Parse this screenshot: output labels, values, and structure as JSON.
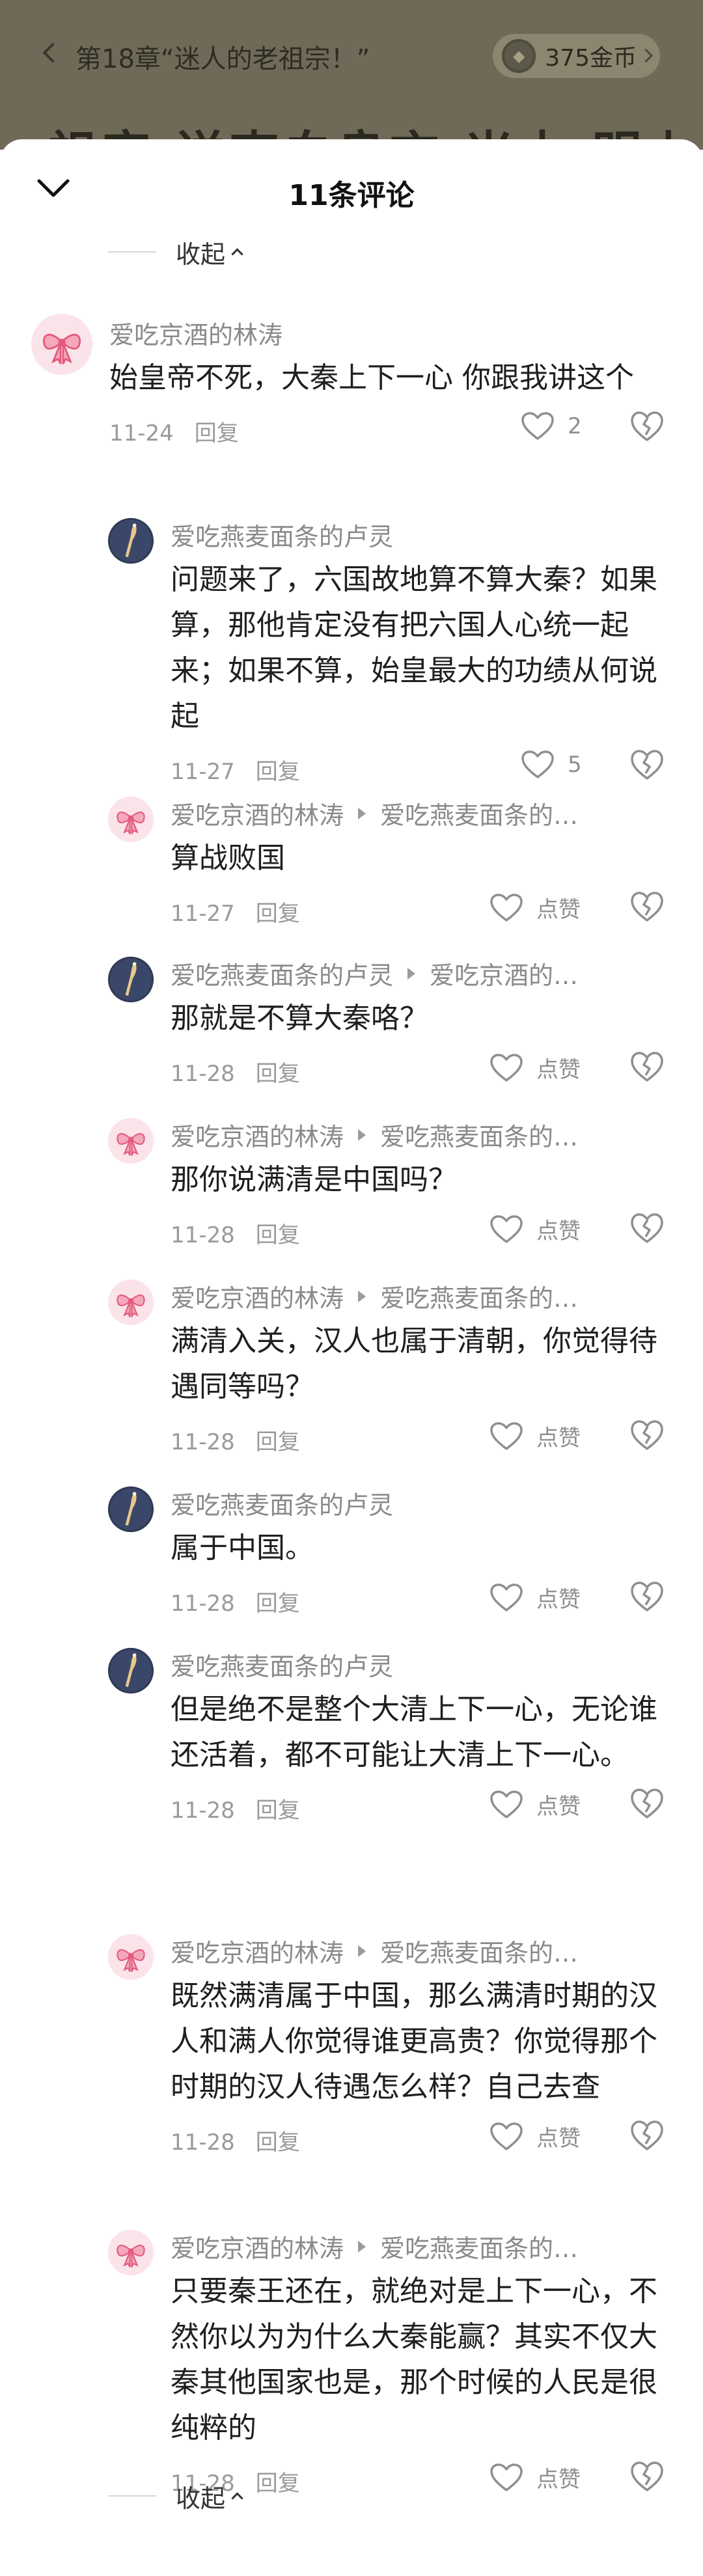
{
  "reader": {
    "back_label": "第18章“迷人的老祖宗！”",
    "coins_label": "375金币",
    "coin_glyph": "◆",
    "body_fragment": "祖宗  送李白良言  米十  明上"
  },
  "sheet": {
    "title": "11条评论",
    "collapse_label": "收起"
  },
  "comments": [
    {
      "user": "爱吃京酒的林涛",
      "target": "",
      "text": "始皇帝不死，大秦上下一心 你跟我讲这个",
      "date": "11-24",
      "reply": "回复",
      "likes": "2",
      "avatar": "lin"
    },
    {
      "user": "爱吃燕麦面条的卢灵",
      "target": "",
      "text": "问题来了，六国故地算不算大秦？如果算，那他肯定没有把六国人心统一起来；如果不算，始皇最大的功绩从何说起",
      "date": "11-27",
      "reply": "回复",
      "likes": "5",
      "avatar": "lu"
    },
    {
      "user": "爱吃京酒的林涛",
      "target": "爱吃燕麦面条的…",
      "text": "算战败国",
      "date": "11-27",
      "reply": "回复",
      "likes": "点赞",
      "avatar": "lin"
    },
    {
      "user": "爱吃燕麦面条的卢灵",
      "target": "爱吃京酒的…",
      "text": "那就是不算大秦咯？",
      "date": "11-28",
      "reply": "回复",
      "likes": "点赞",
      "avatar": "lu"
    },
    {
      "user": "爱吃京酒的林涛",
      "target": "爱吃燕麦面条的…",
      "text": "那你说满清是中国吗？",
      "date": "11-28",
      "reply": "回复",
      "likes": "点赞",
      "avatar": "lin"
    },
    {
      "user": "爱吃京酒的林涛",
      "target": "爱吃燕麦面条的…",
      "text": "满清入关，汉人也属于清朝，你觉得待遇同等吗？",
      "date": "11-28",
      "reply": "回复",
      "likes": "点赞",
      "avatar": "lin"
    },
    {
      "user": "爱吃燕麦面条的卢灵",
      "target": "",
      "text": "属于中国。",
      "date": "11-28",
      "reply": "回复",
      "likes": "点赞",
      "avatar": "lu"
    },
    {
      "user": "爱吃燕麦面条的卢灵",
      "target": "",
      "text": "但是绝不是整个大清上下一心，无论谁还活着，都不可能让大清上下一心。",
      "date": "11-28",
      "reply": "回复",
      "likes": "点赞",
      "avatar": "lu"
    },
    {
      "user": "爱吃京酒的林涛",
      "target": "爱吃燕麦面条的…",
      "text": "既然满清属于中国，那么满清时期的汉人和满人你觉得谁更高贵？你觉得那个时期的汉人待遇怎么样？自己去查",
      "date": "11-28",
      "reply": "回复",
      "likes": "点赞",
      "avatar": "lin"
    },
    {
      "user": "爱吃京酒的林涛",
      "target": "爱吃燕麦面条的…",
      "text": "只要秦王还在，就绝对是上下一心，不然你以为为什么大秦能赢？其实不仅大秦其他国家也是，那个时候的人民是很纯粹的",
      "date": "11-28",
      "reply": "回复",
      "likes": "点赞",
      "avatar": "lin"
    }
  ],
  "colors": {
    "backdrop": "#6f6a58",
    "text_primary": "#1f1f1f",
    "text_secondary": "#8a8a8a",
    "avatar_lin_bg": "#fbe3ea",
    "avatar_lu_bg": "#2f3a55",
    "bow_red": "#e45a7c"
  },
  "icons": {
    "back": "chevron-left-icon",
    "coin": "coin-icon",
    "close_sheet": "chevron-down-icon",
    "like": "heart-outline-icon",
    "dislike": "broken-heart-icon",
    "fold": "caret-up-icon"
  }
}
